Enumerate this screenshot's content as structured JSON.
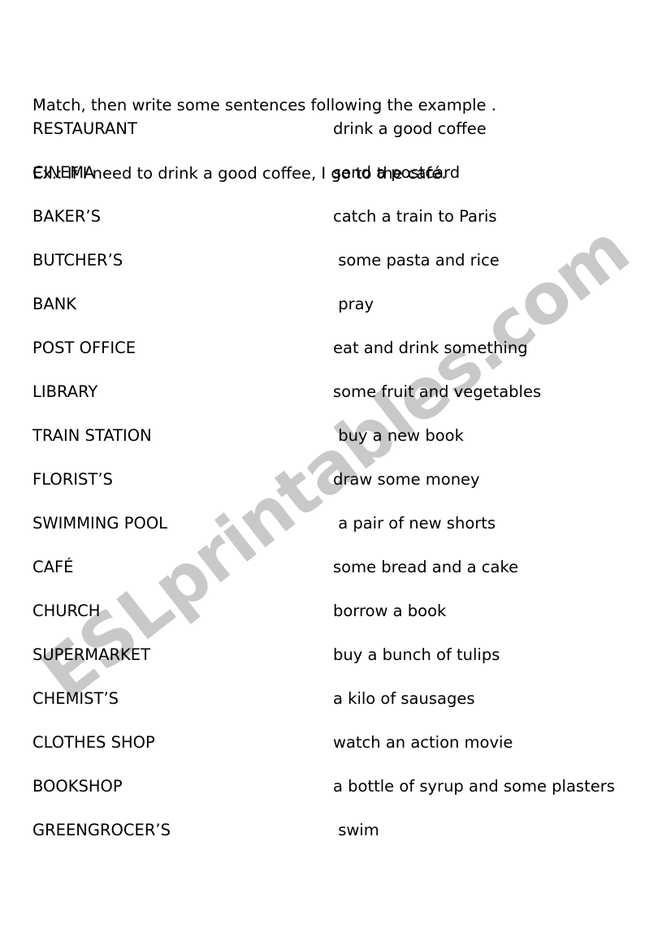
{
  "document": {
    "page_background": "#ffffff",
    "text_color": "#000000",
    "instructions": {
      "line1": "Match, then write some sentences following the example .",
      "line2": "Ex.: If I need to drink a good coffee, I go to the café."
    },
    "watermark": {
      "text": "ESLprintables.com",
      "color": "#c9c9c9"
    },
    "match_rows": [
      {
        "term": "RESTAURANT",
        "phrase": "drink a good coffee"
      },
      {
        "term": "CINEMA",
        "phrase": "send a postcard"
      },
      {
        "term": "BAKER’S",
        "phrase": "catch a train to Paris"
      },
      {
        "term": "BUTCHER’S",
        "phrase": " some pasta and rice"
      },
      {
        "term": "BANK",
        "phrase": " pray"
      },
      {
        "term": "POST OFFICE",
        "phrase": "eat and drink something"
      },
      {
        "term": "LIBRARY",
        "phrase": "some fruit and vegetables"
      },
      {
        "term": "TRAIN STATION",
        "phrase": " buy a new book"
      },
      {
        "term": "FLORIST’S",
        "phrase": "draw some money"
      },
      {
        "term": "SWIMMING POOL",
        "phrase": " a pair of new shorts"
      },
      {
        "term": "CAFÉ",
        "phrase": "some bread and a cake"
      },
      {
        "term": "CHURCH",
        "phrase": "borrow a book"
      },
      {
        "term": "SUPERMARKET",
        "phrase": "buy a bunch of tulips"
      },
      {
        "term": "CHEMIST’S",
        "phrase": "a kilo of sausages"
      },
      {
        "term": "CLOTHES SHOP",
        "phrase": "watch an action movie"
      },
      {
        "term": "BOOKSHOP",
        "phrase": "a bottle of syrup and some plasters"
      },
      {
        "term": "GREENGROCER’S",
        "phrase": " swim"
      }
    ]
  }
}
